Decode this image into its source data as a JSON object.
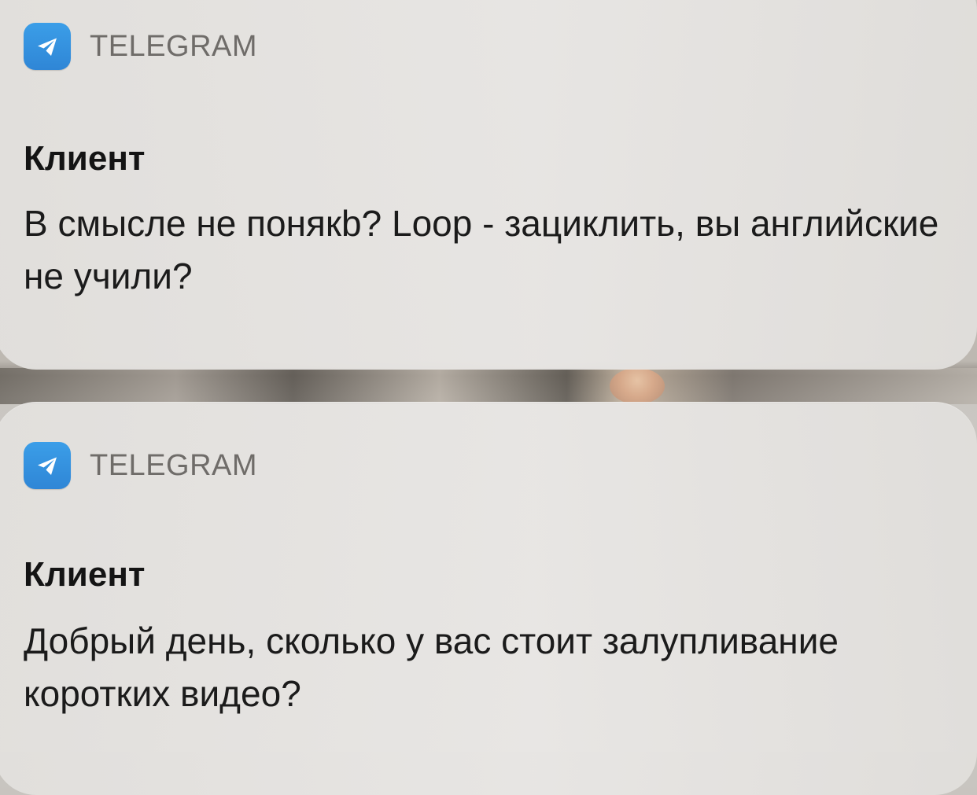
{
  "notifications": [
    {
      "app_name": "TELEGRAM",
      "app_icon": "telegram-icon",
      "sender": "Клиент",
      "message": "В смысле не понякb? Loop - зациклить, вы английские не учили?"
    },
    {
      "app_name": "TELEGRAM",
      "app_icon": "telegram-icon",
      "sender": "Клиент",
      "message": "Добрый день, сколько у вас стоит залупливание коротких видео?"
    }
  ],
  "colors": {
    "telegram_blue": "#2f86d6",
    "card_bg": "#e5e3e0",
    "text_dark": "#141414",
    "app_name_gray": "#6f6c69"
  }
}
